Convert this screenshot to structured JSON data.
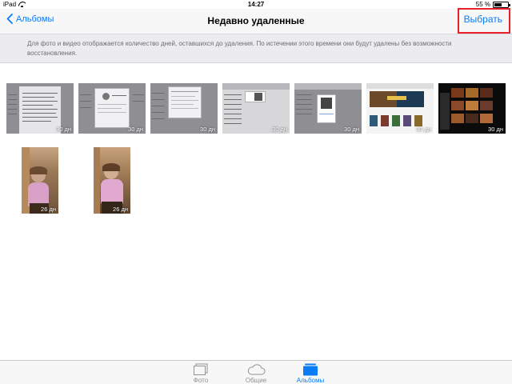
{
  "status_bar": {
    "device": "iPad",
    "time": "14:27",
    "battery": "55 %",
    "battery_level": 0.55
  },
  "nav_bar": {
    "back_label": "Альбомы",
    "title": "Недавно удаленные",
    "select_label": "Выбрать"
  },
  "info_banner": {
    "text": "Для фото и видео отображается количество дней, оставшихся до удаления. По истечении этого времени они будут удалены без возможности восстановления."
  },
  "photos": [
    {
      "days": "30 дн",
      "kind": "screenshot-document"
    },
    {
      "days": "30 дн",
      "kind": "screenshot-profile"
    },
    {
      "days": "30 дн",
      "kind": "screenshot-dialog"
    },
    {
      "days": "30 дн",
      "kind": "screenshot-popup"
    },
    {
      "days": "30 дн",
      "kind": "screenshot-popup"
    },
    {
      "days": "30 дн",
      "kind": "screenshot-web-gallery"
    },
    {
      "days": "30 дн",
      "kind": "screenshot-dark-gallery"
    },
    {
      "days": "26 дн",
      "kind": "photo-portrait"
    },
    {
      "days": "26 дн",
      "kind": "photo-portrait"
    }
  ],
  "tab_bar": {
    "tabs": [
      {
        "label": "Фото",
        "icon": "photos-icon",
        "active": false
      },
      {
        "label": "Общие",
        "icon": "cloud-icon",
        "active": false
      },
      {
        "label": "Альбомы",
        "icon": "albums-icon",
        "active": true
      }
    ]
  },
  "colors": {
    "accent": "#0a7cf5",
    "highlight": "#e8202a",
    "banner_bg": "#ebebf0"
  }
}
